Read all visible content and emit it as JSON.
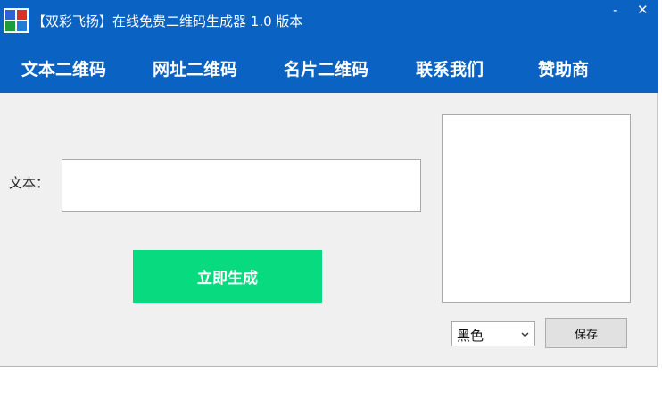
{
  "window": {
    "title": "【双彩飞扬】在线免费二维码生成器 1.0 版本",
    "minimize_glyph": "-",
    "close_glyph": "✕"
  },
  "menu": {
    "items": [
      {
        "label": "文本二维码"
      },
      {
        "label": "网址二维码"
      },
      {
        "label": "名片二维码"
      },
      {
        "label": "联系我们"
      },
      {
        "label": "赞助商"
      }
    ]
  },
  "form": {
    "text_label": "文本：",
    "text_value": "",
    "generate_label": "立即生成"
  },
  "options": {
    "color_selected": "黑色",
    "save_label": "保存"
  },
  "icons": {
    "app": "qr-grid-icon",
    "dropdown": "chevron-down-icon"
  },
  "colors": {
    "titlebar": "#0a62c3",
    "generate_button": "#08da80",
    "window_bg": "#f0f0f0"
  }
}
